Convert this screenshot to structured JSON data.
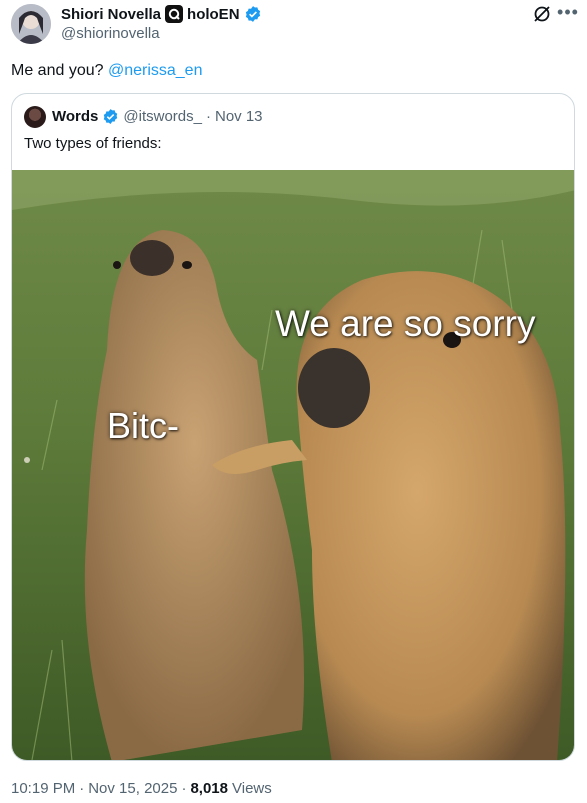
{
  "author": {
    "name": "Shiori Novella",
    "affiliate": "holoEN",
    "handle": "@shiorinovella"
  },
  "tweet": {
    "text": "Me and you? ",
    "mention": "@nerissa_en"
  },
  "quoted": {
    "name": "Words",
    "handle": "@itswords_",
    "separator": "·",
    "date": "Nov 13",
    "text": "Two types of friends:",
    "image_captions": {
      "right": "We are so sorry",
      "left": "Bitc-"
    }
  },
  "meta": {
    "time": "10:19 PM",
    "separator1": "·",
    "date": "Nov 15, 2025",
    "separator2": "·",
    "views_count": "8,018",
    "views_label": "Views"
  },
  "colors": {
    "link": "#1d9bf0",
    "secondary_text": "#536471",
    "border": "#cfd9de"
  },
  "icons": [
    "verified-badge-icon",
    "affiliate-badge-icon",
    "grok-icon",
    "more-options-icon"
  ]
}
